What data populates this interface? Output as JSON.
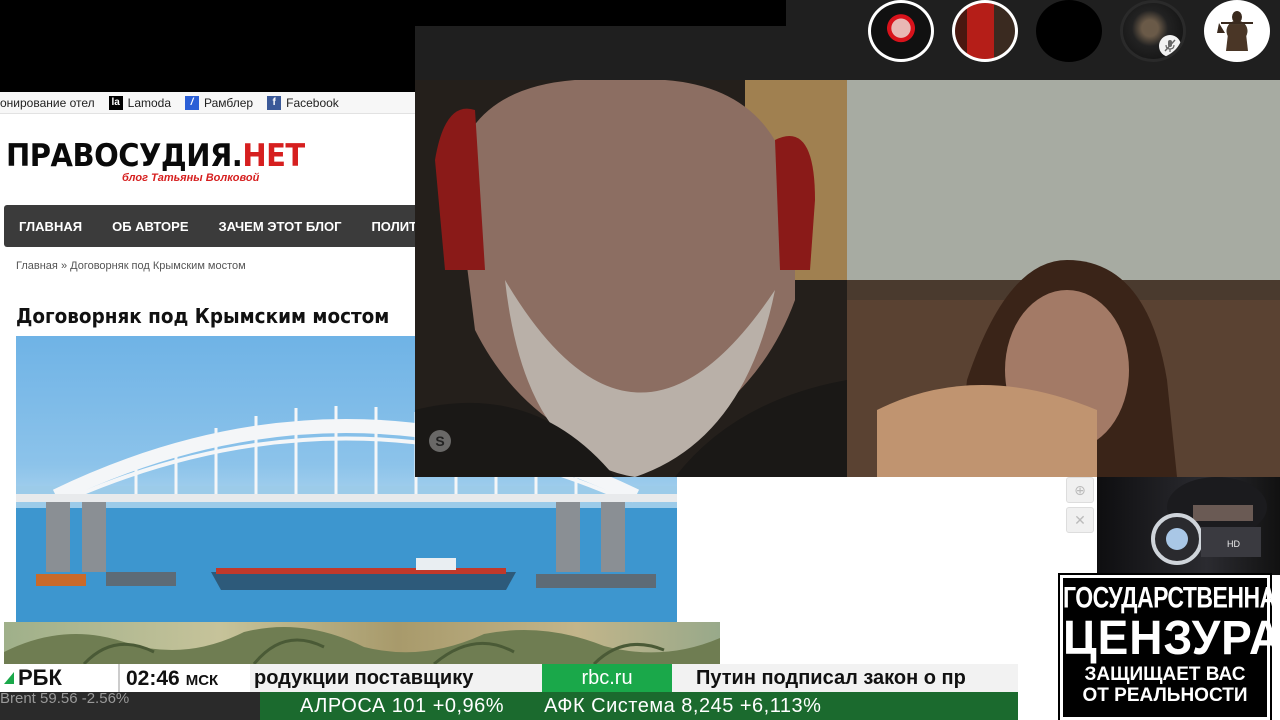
{
  "bookmarks": [
    {
      "label": "онирование отел",
      "icon": "hotel-icon"
    },
    {
      "label": "Lamoda",
      "icon": "lamoda-icon",
      "glyph": "la"
    },
    {
      "label": "Рамблер",
      "icon": "rambler-icon",
      "glyph": "/"
    },
    {
      "label": "Facebook",
      "icon": "facebook-icon",
      "glyph": "f"
    }
  ],
  "site": {
    "logo_main": "ПРАВОСУДИЯ.",
    "logo_net": "НЕТ",
    "logo_sub": "блог Татьяны Волковой",
    "nav": [
      "ГЛАВНАЯ",
      "ОБ АВТОРЕ",
      "ЗАЧЕМ ЭТОТ БЛОГ",
      "ПОЛИТ"
    ],
    "breadcrumb_home": "Главная",
    "breadcrumb_sep": "»",
    "breadcrumb_current": "Договорняк под Крымским мостом",
    "article_title": "Договорняк под Крымским мостом"
  },
  "call": {
    "skype_glyph": "S",
    "mic_off_glyph": "🎙"
  },
  "censor": {
    "line1": "ГОСУДАРСТВЕННАЯ",
    "line2": "ЦЕНЗУРА",
    "line3": "ЗАЩИЩАЕТ ВАС",
    "line4": "ОТ РЕАЛЬНОСТИ"
  },
  "ticker": {
    "channel": "РБК",
    "time": "02:46",
    "timezone": "МСК",
    "news1": "родукции поставщику",
    "site": "rbc.ru",
    "news2": "Путин подписал закон о пр",
    "brent": "Brent 59.56  -2.56%",
    "quote1": "АЛРОСА  101  +0,96%",
    "quote2": "АФК Система  8,245  +6,113%"
  },
  "colors": {
    "rbc_green": "#1aa84a",
    "logo_red": "#d61f1f",
    "nav_bg": "#3b3b3b"
  }
}
